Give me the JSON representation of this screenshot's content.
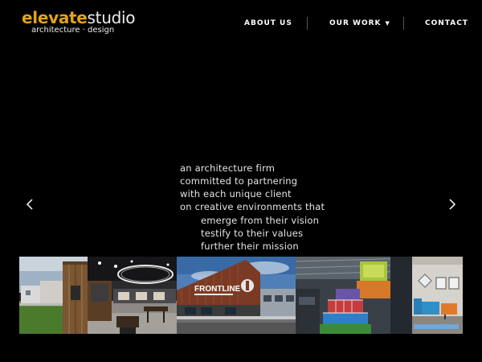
{
  "brand": {
    "word1": "elevate",
    "word2": "studio",
    "subtitle": "architecture · design",
    "accent_color": "#e3a21f"
  },
  "nav": {
    "about": "ABOUT US",
    "work": "OUR WORK",
    "work_caret": "▼",
    "contact": "CONTACT"
  },
  "hero": {
    "lines": [
      "an architecture firm",
      "committed to partnering",
      "with each unique client",
      "on creative environments that",
      "emerge from their vision",
      "testify to their values",
      "further their mission"
    ],
    "prev_icon": "chevron-left-icon",
    "next_icon": "chevron-right-icon"
  },
  "gallery": {
    "building_sign": "FRONTLINE",
    "photos": [
      "exterior-wood-building",
      "interior-cafe-space",
      "frontline-church-exterior",
      "colorful-atrium-interior",
      "lounge-blue-sofa"
    ]
  }
}
